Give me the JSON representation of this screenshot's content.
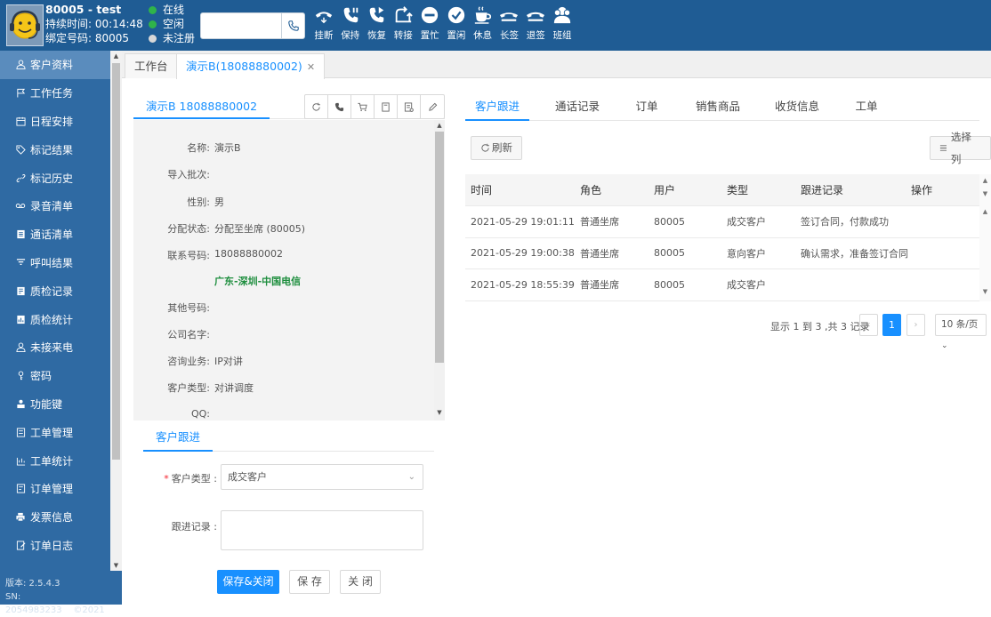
{
  "agent": {
    "title": "80005 - test",
    "duration_label": "持续时间:",
    "duration": "00:14:48",
    "bind_label": "绑定号码:",
    "bind_number": "80005"
  },
  "statuses": [
    {
      "label": "在线",
      "color": "#2fb34a"
    },
    {
      "label": "空闲",
      "color": "#2fb34a"
    },
    {
      "label": "未注册",
      "color": "#d8d8d8"
    }
  ],
  "dial": {
    "placeholder": ""
  },
  "toolbar": [
    {
      "label": "挂断",
      "icon": "hangup-icon"
    },
    {
      "label": "保持",
      "icon": "hold-icon"
    },
    {
      "label": "恢复",
      "icon": "resume-icon"
    },
    {
      "label": "转接",
      "icon": "transfer-icon"
    },
    {
      "label": "置忙",
      "icon": "busy-icon"
    },
    {
      "label": "置闲",
      "icon": "idle-icon"
    },
    {
      "label": "休息",
      "icon": "coffee-icon"
    },
    {
      "label": "长签",
      "icon": "long-sign-icon"
    },
    {
      "label": "退签",
      "icon": "sign-out-icon"
    },
    {
      "label": "班组",
      "icon": "team-icon"
    }
  ],
  "sidebar": {
    "items": [
      {
        "label": "客户资料",
        "icon": "user-icon",
        "active": true
      },
      {
        "label": "工作任务",
        "icon": "flag-icon"
      },
      {
        "label": "日程安排",
        "icon": "calendar-icon"
      },
      {
        "label": "标记结果",
        "icon": "tag-icon"
      },
      {
        "label": "标记历史",
        "icon": "link-icon"
      },
      {
        "label": "录音清单",
        "icon": "tape-icon"
      },
      {
        "label": "通话清单",
        "icon": "list-icon"
      },
      {
        "label": "呼叫结果",
        "icon": "filter-icon"
      },
      {
        "label": "质检记录",
        "icon": "check-doc-icon"
      },
      {
        "label": "质检统计",
        "icon": "stat-doc-icon"
      },
      {
        "label": "未接来电",
        "icon": "missed-call-icon"
      },
      {
        "label": "密码",
        "icon": "key-icon"
      },
      {
        "label": "功能键",
        "icon": "function-key-icon"
      },
      {
        "label": "工单管理",
        "icon": "ticket-icon"
      },
      {
        "label": "工单统计",
        "icon": "ticket-stat-icon"
      },
      {
        "label": "订单管理",
        "icon": "order-icon"
      },
      {
        "label": "发票信息",
        "icon": "printer-icon"
      },
      {
        "label": "订单日志",
        "icon": "order-log-icon"
      }
    ],
    "version": "版本: 2.5.4.3",
    "serial": "SN: 2054983233",
    "year": "©2021"
  },
  "page_tabs": [
    {
      "label": "工作台",
      "active": false
    },
    {
      "label": "演示B(18088880002)",
      "active": true,
      "closable": true
    }
  ],
  "customer": {
    "tab_label": "演示B  18088880002",
    "fields": [
      {
        "label": "名称:",
        "value": "演示B"
      },
      {
        "label": "导入批次:",
        "value": ""
      },
      {
        "label": "性别:",
        "value": "男"
      },
      {
        "label": "分配状态:",
        "value": "分配至坐席 (80005)"
      },
      {
        "label": "联系号码:",
        "value": "18088880002"
      },
      {
        "label": "",
        "value": "广东-深圳-中国电信",
        "location": true
      },
      {
        "label": "其他号码:",
        "value": ""
      },
      {
        "label": "公司名字:",
        "value": ""
      },
      {
        "label": "咨询业务:",
        "value": "IP对讲"
      },
      {
        "label": "客户类型:",
        "value": "对讲调度"
      },
      {
        "label": "QQ:",
        "value": ""
      }
    ]
  },
  "follow_form": {
    "tab_label": "客户跟进",
    "type_label": "客户类型 :",
    "type_value": "成交客户",
    "record_label": "跟进记录 :",
    "record_value": "",
    "save_close_label": "保存&关闭",
    "save_label": "保 存",
    "close_label": "关 闭"
  },
  "right_tabs": [
    "客户跟进",
    "通话记录",
    "订单",
    "销售商品",
    "收货信息",
    "工单"
  ],
  "refresh_label": "刷新",
  "columns_label": "选择列",
  "table": {
    "headers": [
      "时间",
      "角色",
      "用户",
      "类型",
      "跟进记录",
      "操作"
    ],
    "rows": [
      [
        "2021-05-29 19:01:11",
        "普通坐席",
        "80005",
        "成交客户",
        "签订合同，付款成功",
        ""
      ],
      [
        "2021-05-29 19:00:38",
        "普通坐席",
        "80005",
        "意向客户",
        "确认需求，准备签订合同",
        ""
      ],
      [
        "2021-05-29 18:55:39",
        "普通坐席",
        "80005",
        "成交客户",
        "",
        ""
      ]
    ]
  },
  "pagination": {
    "info": "显示 1 到 3 ,共 3 记录",
    "current": "1",
    "page_size": "10 条/页"
  }
}
